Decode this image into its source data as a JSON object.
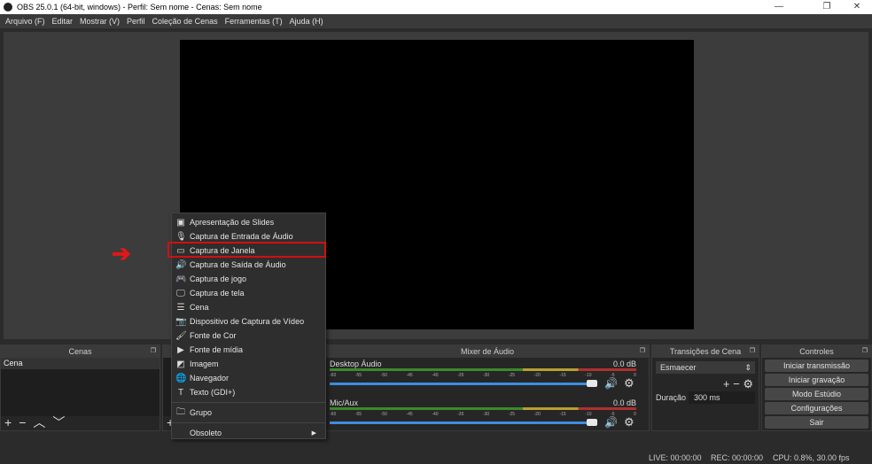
{
  "window": {
    "title": "OBS 25.0.1 (64-bit, windows) - Perfil: Sem nome - Cenas: Sem nome",
    "controls": [
      "—",
      "❐",
      "✕"
    ]
  },
  "menubar": [
    "Arquivo (F)",
    "Editar",
    "Mostrar (V)",
    "Perfil",
    "Coleção de Cenas",
    "Ferramentas (T)",
    "Ajuda (H)"
  ],
  "scenes": {
    "title": "Cenas",
    "items": [
      "Cena"
    ]
  },
  "context_menu": {
    "items": [
      {
        "icon": "slides-icon",
        "glyph": "▣",
        "label": "Apresentação de Slides"
      },
      {
        "icon": "microphone-icon",
        "glyph": "🎙",
        "label": "Captura de Entrada de Áudio"
      },
      {
        "icon": "window-icon",
        "glyph": "▭",
        "label": "Captura de Janela",
        "highlighted": true
      },
      {
        "icon": "speaker-icon",
        "glyph": "🔊",
        "label": "Captura de Saída de Áudio"
      },
      {
        "icon": "gamepad-icon",
        "glyph": "🎮",
        "label": "Captura de jogo"
      },
      {
        "icon": "monitor-icon",
        "glyph": "🖵",
        "label": "Captura de tela"
      },
      {
        "icon": "list-icon",
        "glyph": "☰",
        "label": "Cena"
      },
      {
        "icon": "camera-icon",
        "glyph": "📷",
        "label": "Dispositivo de Captura de Vídeo"
      },
      {
        "icon": "brush-icon",
        "glyph": "🖌",
        "label": "Fonte de Cor"
      },
      {
        "icon": "play-icon",
        "glyph": "▶",
        "label": "Fonte de mídia"
      },
      {
        "icon": "image-icon",
        "glyph": "◩",
        "label": "Imagem"
      },
      {
        "icon": "globe-icon",
        "glyph": "🌐",
        "label": "Navegador"
      },
      {
        "icon": "text-icon",
        "glyph": "T",
        "label": "Texto (GDI+)"
      }
    ],
    "group": {
      "icon": "folder-icon",
      "glyph": "🗀",
      "label": "Grupo"
    },
    "deprecated": "Obsoleto"
  },
  "mixer": {
    "title": "Mixer de Áudio",
    "ticks": [
      "-60",
      "-55",
      "-50",
      "-45",
      "-40",
      "-35",
      "-30",
      "-25",
      "-20",
      "-15",
      "-10",
      "-5",
      "0"
    ],
    "channels": [
      {
        "name": "Desktop Áudio",
        "level": "0.0 dB",
        "volume": 1.0
      },
      {
        "name": "Mic/Aux",
        "level": "0.0 dB",
        "volume": 1.0
      }
    ]
  },
  "transitions": {
    "title": "Transições de Cena",
    "selected": "Esmaecer",
    "duration_label": "Duração",
    "duration": "300 ms"
  },
  "controls": {
    "title": "Controles",
    "buttons": [
      "Iniciar transmissão",
      "Iniciar gravação",
      "Modo Estúdio",
      "Configurações",
      "Sair"
    ]
  },
  "status": {
    "live": "LIVE: 00:00:00",
    "rec": "REC: 00:00:00",
    "cpu": "CPU: 0.8%, 30.00 fps"
  },
  "colors": {
    "highlight_box": "#d01010",
    "arrow": "#e01818",
    "slider": "#3d8ee0"
  }
}
